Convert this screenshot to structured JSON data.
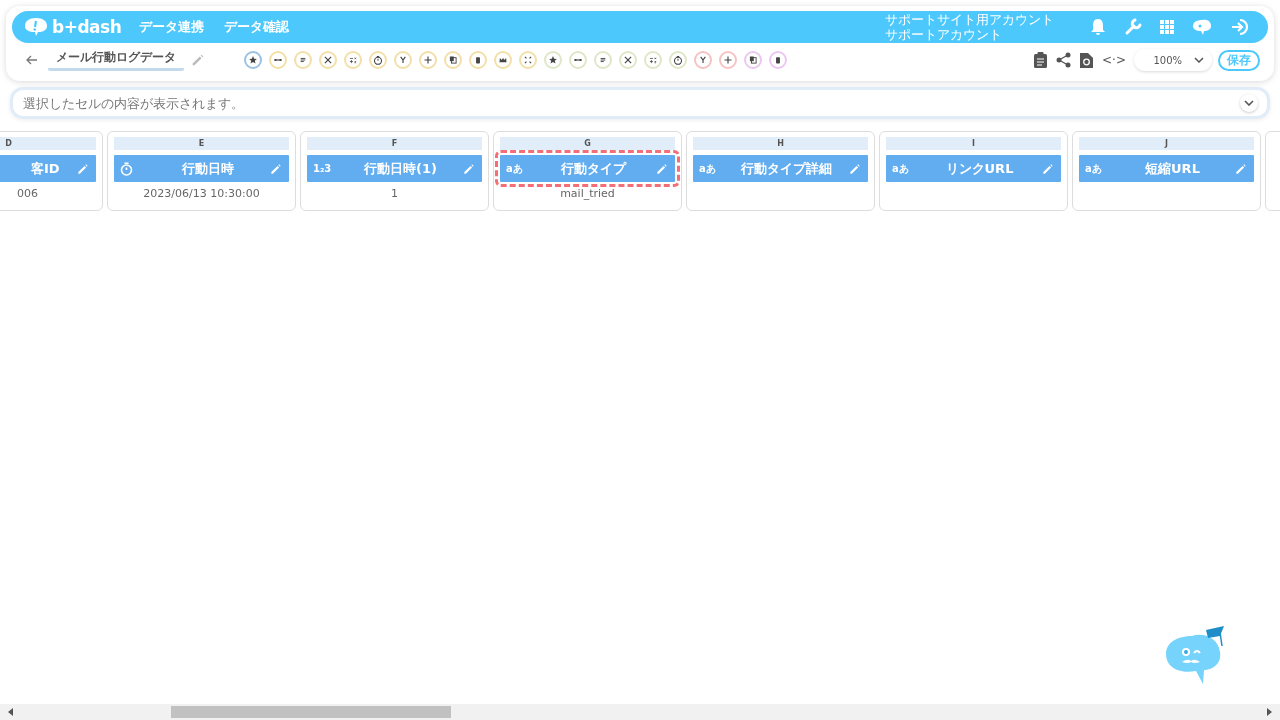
{
  "header": {
    "logo": "b+dash",
    "nav": [
      "データ連携",
      "データ確認"
    ],
    "account": [
      "サポートサイト用アカウント",
      "サポートアカウント"
    ]
  },
  "toolbar": {
    "title": "メール行動ログデータ",
    "tools": [
      {
        "color": "#9cc3e6"
      },
      {
        "color": "#f3dfa8"
      },
      {
        "color": "#f3dfa8"
      },
      {
        "color": "#f3dfa8"
      },
      {
        "color": "#f3dfa8"
      },
      {
        "color": "#f3dfa8"
      },
      {
        "color": "#f3dfa8"
      },
      {
        "color": "#f3dfa8"
      },
      {
        "color": "#f3dfa8"
      },
      {
        "color": "#f3dfa8"
      },
      {
        "color": "#f3dfa8"
      },
      {
        "color": "#f3dfa8"
      },
      {
        "color": "#dfe7c8"
      },
      {
        "color": "#dfe7c8"
      },
      {
        "color": "#dfe7c8"
      },
      {
        "color": "#dfe7c8"
      },
      {
        "color": "#dfe7c8"
      },
      {
        "color": "#dfe7c8"
      },
      {
        "color": "#f6c3c3"
      },
      {
        "color": "#f6c3c3"
      },
      {
        "color": "#ecc8f0"
      },
      {
        "color": "#ecc8f0"
      }
    ],
    "code_toggle": "<·>",
    "zoom": "100%",
    "save": "保存"
  },
  "formula_bar": {
    "placeholder": "選択したセルの内容が表示されます。"
  },
  "columns": [
    {
      "letter": "D",
      "name": "客ID",
      "kind": "plain",
      "value": "006",
      "selected": false
    },
    {
      "letter": "E",
      "name": "行動日時",
      "kind": "datetime",
      "value": "2023/06/13 10:30:00",
      "selected": false
    },
    {
      "letter": "F",
      "name": "行動日時(1)",
      "kind": "number",
      "type_label": "1₂3",
      "value": "1",
      "selected": false
    },
    {
      "letter": "G",
      "name": "行動タイプ",
      "kind": "text",
      "type_label": "aあ",
      "value": "mail_tried",
      "selected": true
    },
    {
      "letter": "H",
      "name": "行動タイプ詳細",
      "kind": "text",
      "type_label": "aあ",
      "selected": false
    },
    {
      "letter": "I",
      "name": "リンクURL",
      "kind": "text",
      "type_label": "aあ",
      "selected": false
    },
    {
      "letter": "J",
      "name": "短縮URL",
      "kind": "text",
      "type_label": "aあ",
      "selected": false
    }
  ]
}
